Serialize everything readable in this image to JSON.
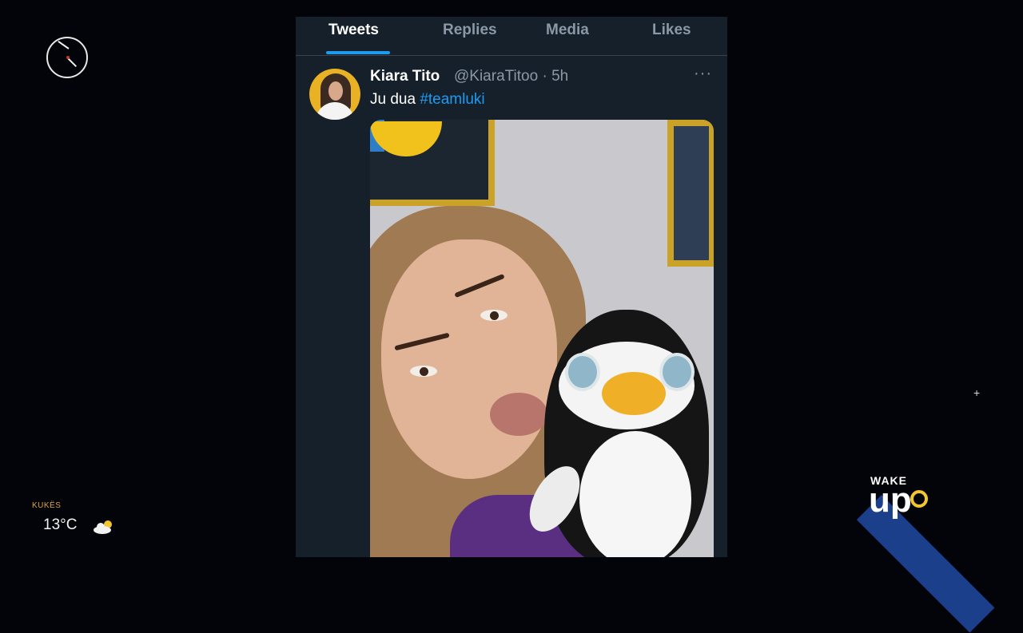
{
  "clock": {
    "icon": "analog-clock-icon"
  },
  "weather": {
    "city": "KUKËS",
    "temperature": "13°C",
    "icon": "partly-cloudy-icon"
  },
  "tabs": [
    {
      "label": "Tweets",
      "active": true
    },
    {
      "label": "Replies",
      "active": false
    },
    {
      "label": "Media",
      "active": false
    },
    {
      "label": "Likes",
      "active": false
    }
  ],
  "tweet": {
    "author_name": "Kiara Tito",
    "handle": "@KiaraTitoo",
    "time": "· 5h",
    "more": "···",
    "text": "Ju dua",
    "hashtag": "#teamluki"
  },
  "logo": {
    "top": "WAKE",
    "bottom": "up"
  },
  "colors": {
    "accent": "#1d9bf0",
    "background": "#15202b",
    "muted": "#8b98a5",
    "logo_band": "#1b3f8a"
  }
}
